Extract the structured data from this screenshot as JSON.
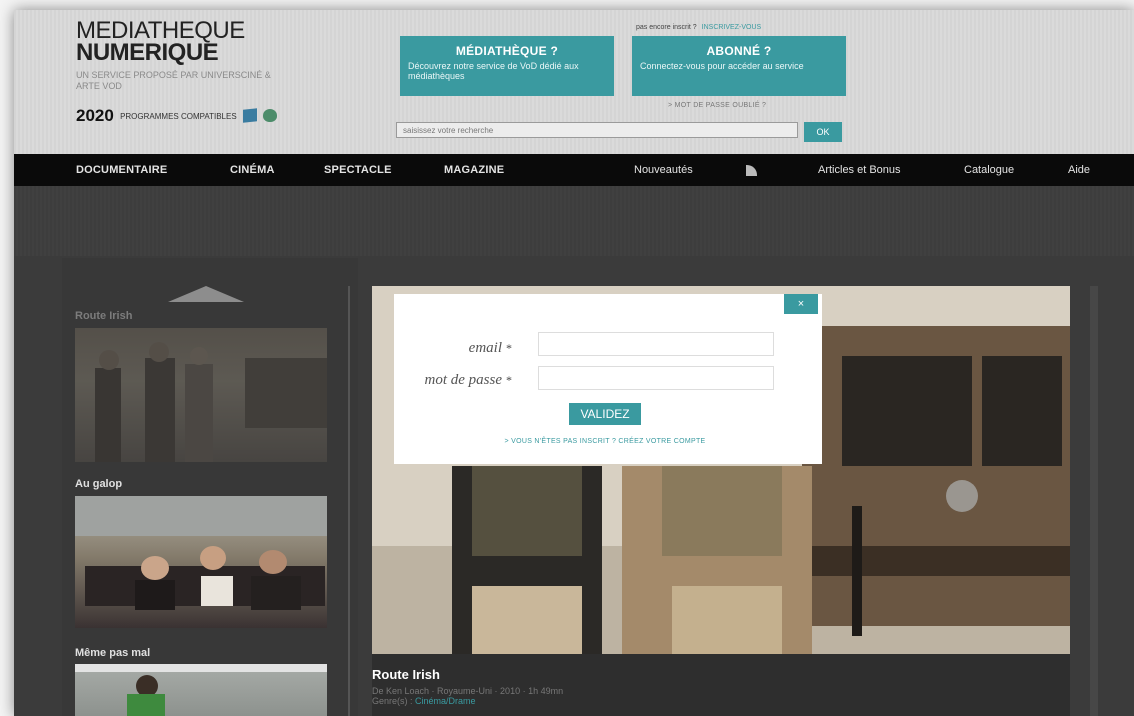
{
  "brand": {
    "line1": "MEDIATHEQUE",
    "line2": "NUMERIQUE",
    "tagline": "UN SERVICE PROPOSÉ PAR UNIVERSCINÉ & ARTE VOD",
    "program_count": "2020",
    "program_label": "PROGRAMMES COMPATIBLES",
    "os_icons": [
      "windows-icon",
      "apple-icon"
    ]
  },
  "account": {
    "question": "pas encore inscrit ?",
    "link": "INSCRIVEZ-VOUS"
  },
  "cards": [
    {
      "title": "MÉDIATHÈQUE ?",
      "text": "Découvrez notre service de VoD dédié aux médiathèques"
    },
    {
      "title": "ABONNÉ ?",
      "text": "Connectez-vous pour accéder au service"
    }
  ],
  "forgot_password": "> MOT DE PASSE OUBLIÉ ?",
  "search": {
    "placeholder": "saisissez votre recherche",
    "button": "OK"
  },
  "nav": {
    "main": [
      "DOCUMENTAIRE",
      "CINÉMA",
      "SPECTACLE",
      "MAGAZINE"
    ],
    "secondary": [
      "Nouveautés",
      "Articles et Bonus",
      "Catalogue",
      "Aide"
    ],
    "rss_icon": "rss-icon"
  },
  "sidebar": {
    "items": [
      {
        "title": "Route Irish"
      },
      {
        "title": "Au galop"
      },
      {
        "title": "Même pas mal"
      }
    ]
  },
  "featured": {
    "title": "Route Irish",
    "meta_prefix": "De Ken Loach · Royaume-Uni · 2010 · 1h 49mn",
    "genre_label": "Genre(s) :",
    "genre": "Cinéma/Drame"
  },
  "login": {
    "email_label": "email",
    "password_label": "mot de passe",
    "required_mark": "*",
    "submit": "VALIDEZ",
    "signup": "> VOUS N'ÊTES PAS INSCRIT ? CRÉEZ VOTRE COMPTE",
    "close": "×"
  },
  "colors": {
    "accent": "#3a9aa0",
    "nav_bg": "#0a0a0a",
    "page_bg": "#3b3b3b"
  }
}
